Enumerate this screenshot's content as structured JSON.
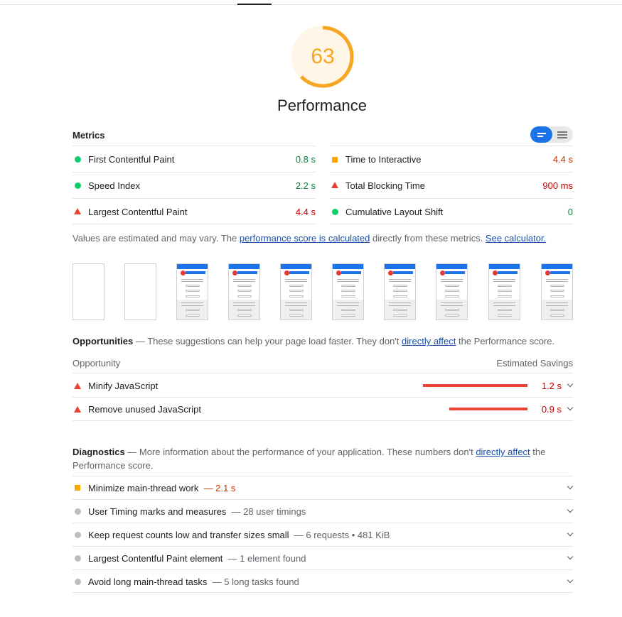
{
  "colors": {
    "score_orange": "#f5a623",
    "pass_green": "#0cce6b",
    "average_orange": "#ffa400",
    "fail_red": "#eb4034",
    "link_blue": "#1a4fa8",
    "toggle_blue": "#1a73e8"
  },
  "gauge": {
    "score": "63",
    "score_fraction": 0.63,
    "title": "Performance"
  },
  "metrics": {
    "title": "Metrics",
    "view_toggle": {
      "selected": "compact-view",
      "icons": [
        "compact-view-icon",
        "expanded-view-icon"
      ]
    },
    "items": [
      {
        "label": "First Contentful Paint",
        "value": "0.8 s",
        "status": "pass",
        "icon": "green-circle-icon"
      },
      {
        "label": "Time to Interactive",
        "value": "4.4 s",
        "status": "average",
        "icon": "orange-square-icon"
      },
      {
        "label": "Speed Index",
        "value": "2.2 s",
        "status": "pass",
        "icon": "green-circle-icon"
      },
      {
        "label": "Total Blocking Time",
        "value": "900 ms",
        "status": "fail",
        "icon": "red-triangle-icon"
      },
      {
        "label": "Largest Contentful Paint",
        "value": "4.4 s",
        "status": "fail",
        "icon": "red-triangle-icon"
      },
      {
        "label": "Cumulative Layout Shift",
        "value": "0",
        "status": "pass",
        "icon": "green-circle-icon"
      }
    ]
  },
  "note": {
    "text_before": "Values are estimated and may vary. The ",
    "link1": "performance score is calculated",
    "text_middle": " directly from these metrics. ",
    "link2": "See calculator."
  },
  "filmstrip": {
    "frames": [
      "blank",
      "blank",
      "loaded",
      "loaded",
      "loaded",
      "loaded",
      "loaded",
      "loaded",
      "loaded",
      "loaded"
    ]
  },
  "opportunities": {
    "title": "Opportunities",
    "desc_before": " — These suggestions can help your page load faster. They don't ",
    "link": "directly affect",
    "desc_after": " the Performance score.",
    "col_left": "Opportunity",
    "col_right": "Estimated Savings",
    "items": [
      {
        "label": "Minify JavaScript",
        "value": "1.2 s",
        "savings_s": 1.2
      },
      {
        "label": "Remove unused JavaScript",
        "value": "0.9 s",
        "savings_s": 0.9
      }
    ]
  },
  "diagnostics": {
    "title": "Diagnostics",
    "desc_before": " — More information about the performance of your application. These numbers don't ",
    "link": "directly affect",
    "desc_after": " the Performance score.",
    "items": [
      {
        "label": "Minimize main-thread work",
        "detail": "— 2.1 s",
        "status": "average",
        "icon": "orange-square-icon"
      },
      {
        "label": "User Timing marks and measures",
        "detail": "— 28 user timings",
        "status": "info",
        "icon": "gray-circle-icon"
      },
      {
        "label": "Keep request counts low and transfer sizes small",
        "detail": "— 6 requests • 481 KiB",
        "status": "info",
        "icon": "gray-circle-icon"
      },
      {
        "label": "Largest Contentful Paint element",
        "detail": "— 1 element found",
        "status": "info",
        "icon": "gray-circle-icon"
      },
      {
        "label": "Avoid long main-thread tasks",
        "detail": "— 5 long tasks found",
        "status": "info",
        "icon": "gray-circle-icon"
      }
    ]
  }
}
